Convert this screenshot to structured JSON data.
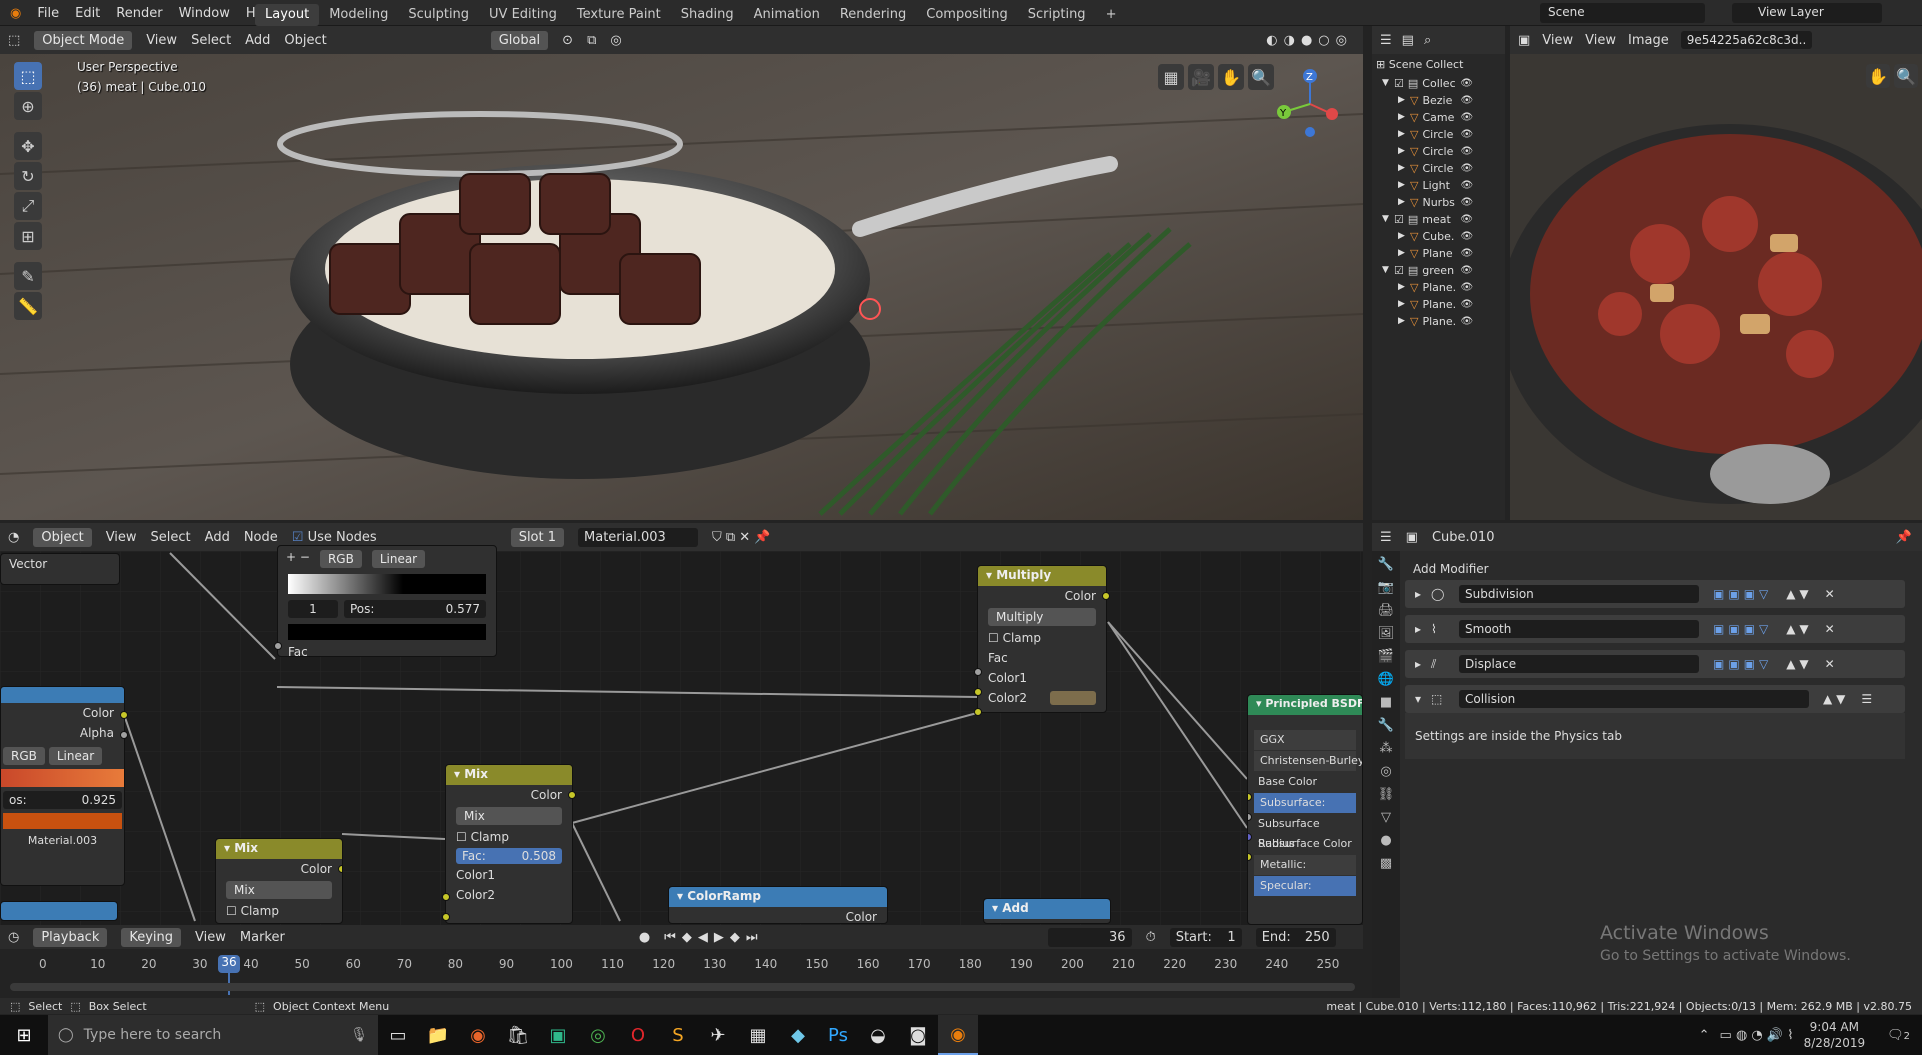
{
  "topbar": {
    "menus": [
      "File",
      "Edit",
      "Render",
      "Window",
      "Help"
    ],
    "workspaces": [
      "Layout",
      "Modeling",
      "Sculpting",
      "UV Editing",
      "Texture Paint",
      "Shading",
      "Animation",
      "Rendering",
      "Compositing",
      "Scripting"
    ],
    "active_workspace": "Layout",
    "scene": "Scene",
    "view_layer": "View Layer"
  },
  "viewport": {
    "mode": "Object Mode",
    "menus": [
      "View",
      "Select",
      "Add",
      "Object"
    ],
    "orientation": "Global",
    "overlay_title": "User Perspective",
    "overlay_sub": "(36) meat | Cube.010"
  },
  "outliner": {
    "root": "Scene Collect",
    "rows": [
      {
        "label": "Collec",
        "indent": 1,
        "check": true,
        "expand": "▼"
      },
      {
        "label": "Bezie",
        "indent": 2,
        "check": false,
        "expand": "▶"
      },
      {
        "label": "Came",
        "indent": 2,
        "check": false,
        "expand": "▶"
      },
      {
        "label": "Circle",
        "indent": 2,
        "check": false,
        "expand": "▶"
      },
      {
        "label": "Circle",
        "indent": 2,
        "check": false,
        "expand": "▶"
      },
      {
        "label": "Circle",
        "indent": 2,
        "check": false,
        "expand": "▶"
      },
      {
        "label": "Light",
        "indent": 2,
        "check": false,
        "expand": "▶"
      },
      {
        "label": "Nurbs",
        "indent": 2,
        "check": false,
        "expand": "▶"
      },
      {
        "label": "meat",
        "indent": 1,
        "check": true,
        "expand": "▼"
      },
      {
        "label": "Cube.",
        "indent": 2,
        "check": false,
        "expand": "▶"
      },
      {
        "label": "Plane",
        "indent": 2,
        "check": false,
        "expand": "▶"
      },
      {
        "label": "green",
        "indent": 1,
        "check": true,
        "expand": "▼"
      },
      {
        "label": "Plane.",
        "indent": 2,
        "check": false,
        "expand": "▶"
      },
      {
        "label": "Plane.",
        "indent": 2,
        "check": false,
        "expand": "▶"
      },
      {
        "label": "Plane.",
        "indent": 2,
        "check": false,
        "expand": "▶"
      }
    ]
  },
  "image_editor": {
    "menus": [
      "View",
      "View",
      "Image"
    ],
    "image_name": "9e54225a62c8c3d.."
  },
  "node_editor": {
    "mode": "Object",
    "menus": [
      "View",
      "Select",
      "Add",
      "Node"
    ],
    "use_nodes": "Use Nodes",
    "slot": "Slot 1",
    "material": "Material.003",
    "vector_label": "Vector",
    "colorramp1": {
      "mode": "RGB",
      "interp": "Linear",
      "index": "1",
      "pos_label": "Pos:",
      "pos": "0.577",
      "out": "Fac"
    },
    "colorramp2": {
      "out_color": "Color",
      "out_alpha": "Alpha",
      "mode": "RGB",
      "interp": "Linear",
      "pos_label": "os:",
      "pos": "0.925",
      "material": "Material.003"
    },
    "multiply": {
      "title": "Multiply",
      "out": "Color",
      "blend": "Multiply",
      "clamp": "Clamp",
      "fac": "Fac",
      "c1": "Color1",
      "c2": "Color2"
    },
    "mix1": {
      "title": "Mix",
      "out": "Color",
      "blend": "Mix",
      "clamp": "Clamp",
      "fac_label": "Fac:",
      "fac": "0.508",
      "c1": "Color1",
      "c2": "Color2"
    },
    "mix2": {
      "title": "Mix",
      "out": "Color",
      "blend": "Mix",
      "clamp": "Clamp"
    },
    "colorramp3": {
      "title": "ColorRamp",
      "out": "Color"
    },
    "add": {
      "title": "Add"
    },
    "bsdf": {
      "title": "Principled BSDF",
      "dist": "GGX",
      "ss_method": "Christensen-Burley",
      "base": "Base Color",
      "subsurface": "Subsurface:",
      "ss_radius": "Subsurface Radius",
      "ss_color": "Subsurface Color",
      "metallic": "Metallic:",
      "specular": "Specular:"
    }
  },
  "properties": {
    "object": "Cube.010",
    "add_modifier": "Add Modifier",
    "modifiers": [
      "Subdivision",
      "Smooth",
      "Displace",
      "Collision"
    ],
    "collision_note": "Settings are inside the Physics tab",
    "watermark_title": "Activate Windows",
    "watermark_sub": "Go to Settings to activate Windows."
  },
  "timeline": {
    "menus": [
      "Playback",
      "Keying",
      "View",
      "Marker"
    ],
    "current_frame": "36",
    "start_label": "Start:",
    "start": "1",
    "end_label": "End:",
    "end": "250",
    "ticks": [
      "0",
      "10",
      "20",
      "30",
      "40",
      "50",
      "60",
      "70",
      "80",
      "90",
      "100",
      "110",
      "120",
      "130",
      "140",
      "150",
      "160",
      "170",
      "180",
      "190",
      "200",
      "210",
      "220",
      "230",
      "240",
      "250"
    ]
  },
  "statusbar": {
    "select": "Select",
    "box_select": "Box Select",
    "context_menu": "Object Context Menu",
    "stats": "meat | Cube.010 | Verts:112,180 | Faces:110,962 | Tris:221,924 | Objects:0/13 | Mem: 262.9 MB | v2.80.75"
  },
  "taskbar": {
    "search_placeholder": "Type here to search",
    "time": "9:04 AM",
    "date": "8/28/2019",
    "notification_count": "2"
  }
}
